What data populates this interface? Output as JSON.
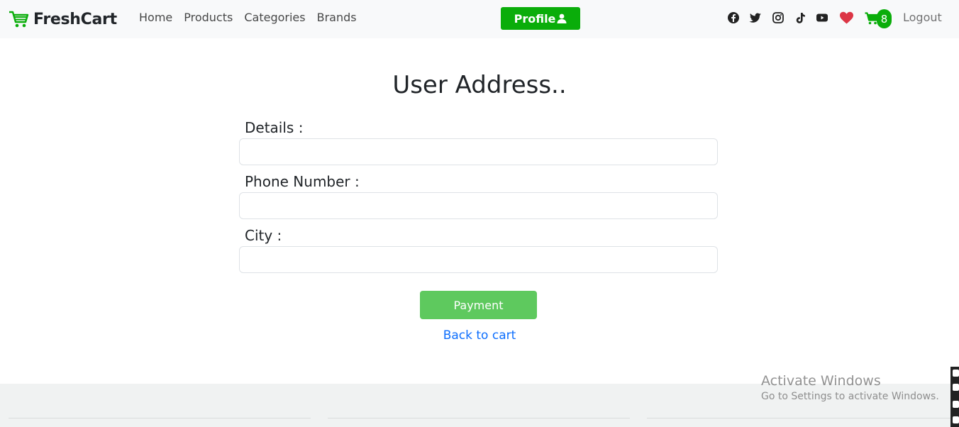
{
  "navbar": {
    "brand": "FreshCart",
    "links": [
      "Home",
      "Products",
      "Categories",
      "Brands"
    ],
    "profile_label": "Profile",
    "cart_count": "8",
    "logout_label": "Logout",
    "social_icons": [
      "facebook-icon",
      "twitter-icon",
      "instagram-icon",
      "tiktok-icon",
      "youtube-icon"
    ]
  },
  "form": {
    "title": "User Address..",
    "details_label": "Details :",
    "details_value": "",
    "phone_label": "Phone Number :",
    "phone_value": "",
    "city_label": "City :",
    "city_value": "",
    "submit_label": "Payment",
    "back_label": "Back to cart"
  },
  "watermark": {
    "title": "Activate Windows",
    "subtitle": "Go to Settings to activate Windows."
  },
  "colors": {
    "brand_green": "#0aad0a",
    "button_green_disabled": "#5ec95e",
    "link_blue": "#0d6efd",
    "heart_red": "#dc3545",
    "navbar_bg": "#f8f9fa",
    "footer_bg": "#f0f2f2"
  }
}
